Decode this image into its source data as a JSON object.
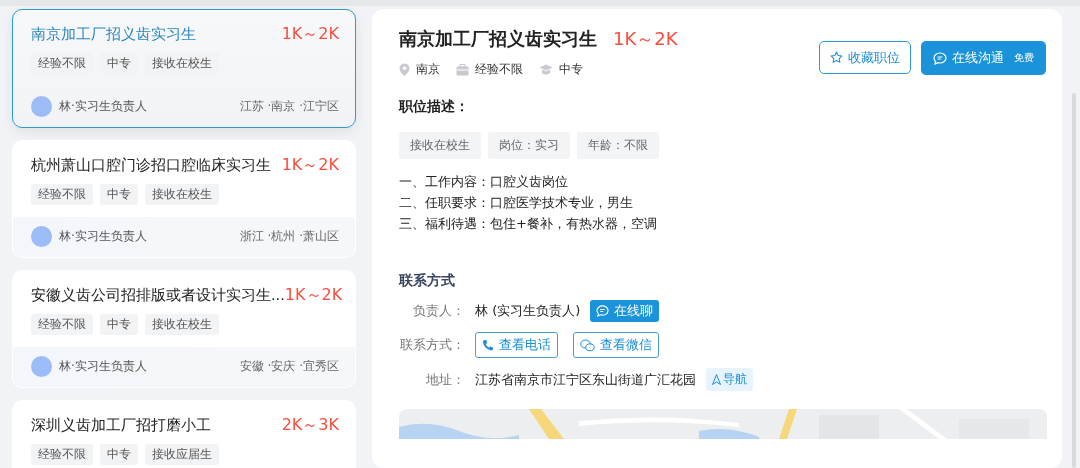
{
  "jobs": [
    {
      "title": "南京加工厂招义齿实习生",
      "salary": "1K～2K",
      "tags": [
        "经验不限",
        "中专",
        "接收在校生"
      ],
      "recruiter": "林·实习生负责人",
      "location": "江苏 ·南京 ·江宁区",
      "selected": true
    },
    {
      "title": "杭州萧山口腔门诊招口腔临床实习生",
      "salary": "1K～2K",
      "tags": [
        "经验不限",
        "中专",
        "接收在校生"
      ],
      "recruiter": "林·实习生负责人",
      "location": "浙江 ·杭州 ·萧山区",
      "selected": false
    },
    {
      "title": "安徽义齿公司招排版或者设计实习生...",
      "salary": "1K～2K",
      "tags": [
        "经验不限",
        "中专",
        "接收在校生"
      ],
      "recruiter": "林·实习生负责人",
      "location": "安徽 ·安庆 ·宜秀区",
      "selected": false
    },
    {
      "title": "深圳义齿加工厂招打磨小工",
      "salary": "2K～3K",
      "tags": [
        "经验不限",
        "中专",
        "接收应届生"
      ],
      "selected": false
    }
  ],
  "detail": {
    "title": "南京加工厂招义齿实习生",
    "salary": "1K～2K",
    "meta": [
      {
        "kind": "location",
        "text": "南京"
      },
      {
        "kind": "experience",
        "text": "经验不限"
      },
      {
        "kind": "education",
        "text": "中专"
      }
    ],
    "favorite_button": "收藏职位",
    "chat_button": "在线沟通",
    "chat_badge": "免费",
    "description_heading": "职位描述：",
    "description_tags": [
      "接收在校生",
      "岗位：实习",
      "年龄：不限"
    ],
    "description_lines": [
      "一、工作内容：口腔义齿岗位",
      "二、任职要求：口腔医学技术专业，男生",
      "三、福利待遇：包住+餐补，有热水器，空调"
    ],
    "contact_heading": "联系方式",
    "contact_person_label": "负责人：",
    "contact_person": "林 (实习生负责人)",
    "online_chat_button": "在线聊",
    "contact_method_label": "联系方式：",
    "phone_button": "查看电话",
    "wechat_button": "查看微信",
    "address_label": "地址：",
    "address": "江苏省南京市江宁区东山街道广汇花园",
    "navigate_button": "导航",
    "map": {
      "kind": "picture"
    }
  }
}
